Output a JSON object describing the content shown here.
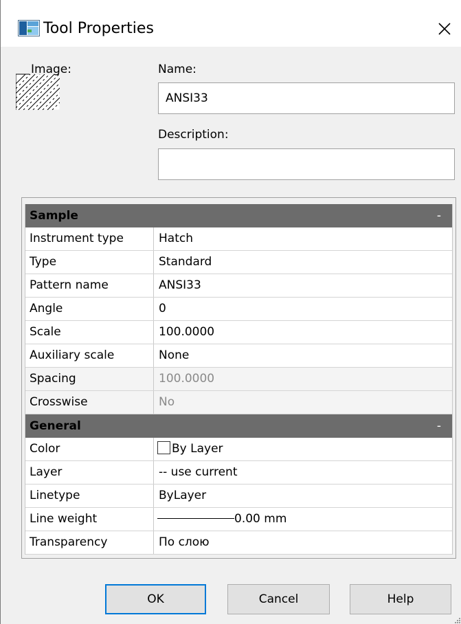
{
  "window": {
    "title": "Tool Properties",
    "icon": "tool-properties-app-icon",
    "close_icon": "close-icon"
  },
  "image_section": {
    "label": "Image:",
    "preview_icon": "hatch-pattern-preview-icon"
  },
  "name_field": {
    "label": "Name:",
    "value": "ANSI33"
  },
  "description_field": {
    "label": "Description:",
    "value": ""
  },
  "sample_section": {
    "title": "Sample",
    "collapse_label": "-",
    "rows": [
      {
        "key": "Instrument type",
        "value": "Hatch"
      },
      {
        "key": "Type",
        "value": "Standard"
      },
      {
        "key": "Pattern name",
        "value": "ANSI33"
      },
      {
        "key": "Angle",
        "value": "0"
      },
      {
        "key": "Scale",
        "value": "100.0000"
      },
      {
        "key": "Auxiliary scale",
        "value": "None"
      },
      {
        "key": "Spacing",
        "value": "100.0000"
      },
      {
        "key": "Crosswise",
        "value": "No"
      }
    ]
  },
  "general_section": {
    "title": "General",
    "collapse_label": "-",
    "color": {
      "key": "Color",
      "value": "By Layer"
    },
    "layer": {
      "key": "Layer",
      "value": "-- use current"
    },
    "linetype": {
      "key": "Linetype",
      "value": "ByLayer"
    },
    "line_weight": {
      "key": "Line weight",
      "value": "0.00 mm"
    },
    "transparency": {
      "key": "Transparency",
      "value": "По слою"
    }
  },
  "buttons": {
    "ok": "OK",
    "cancel": "Cancel",
    "help": "Help"
  },
  "colors": {
    "section_header_bg": "#6c6c6c",
    "dialog_bg": "#f0f0f0",
    "default_button_border": "#0078d7",
    "disabled_text": "#8a8a8a"
  }
}
